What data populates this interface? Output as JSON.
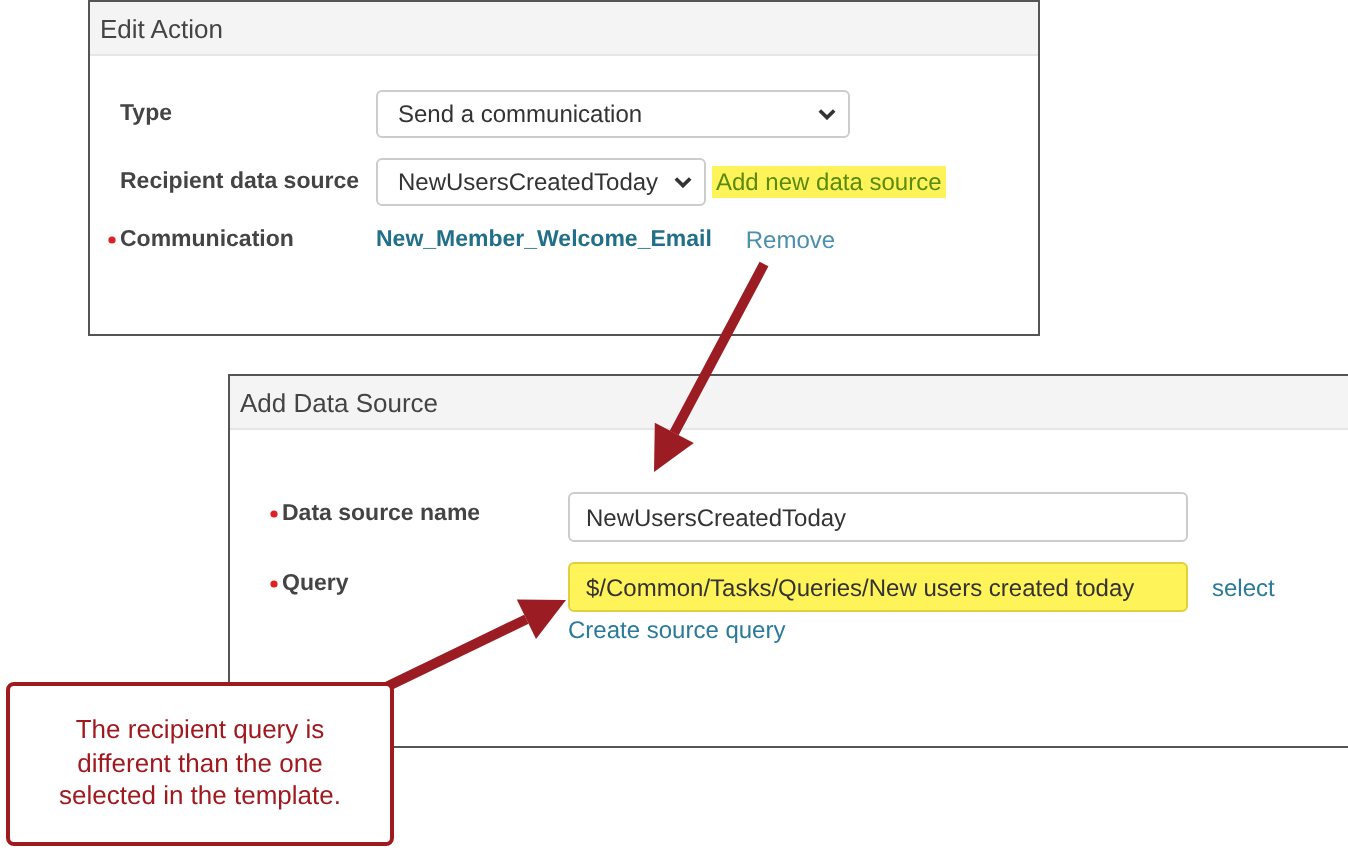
{
  "edit_action": {
    "title": "Edit Action",
    "fields": [
      {
        "kind": "select",
        "label": "Type",
        "required": false,
        "value": "Send a communication"
      },
      {
        "kind": "select",
        "label": "Recipient data source",
        "required": false,
        "value": "NewUsersCreatedToday",
        "link": {
          "text": "Add new data source",
          "highlighted": true
        }
      },
      {
        "kind": "link",
        "label": "Communication",
        "required": true,
        "value": "New_Member_Welcome_Email",
        "action": "Remove"
      }
    ]
  },
  "add_data_source": {
    "title": "Add Data Source",
    "fields": [
      {
        "kind": "input",
        "label": "Data source name",
        "required": true,
        "value": "NewUsersCreatedToday",
        "highlighted": false
      },
      {
        "kind": "input",
        "label": "Query",
        "required": true,
        "value": "$/Common/Tasks/Queries/New users created today",
        "highlighted": true,
        "action": "select",
        "link": "Create source query"
      }
    ]
  },
  "callout": {
    "text": "The recipient query is different than the one selected in the template."
  }
}
